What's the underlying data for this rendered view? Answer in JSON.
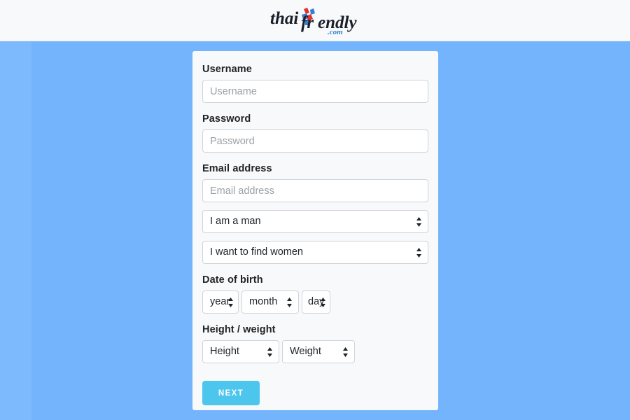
{
  "header": {
    "logo": {
      "name": "thaifriendly-logo",
      "text_part1": "thai",
      "text_part2": "fr",
      "text_part3": "endly",
      "domain_text": ".com",
      "colors": {
        "text": "#1b1f2a",
        "red": "#e8302f",
        "blue": "#2f7fd4",
        "domain": "#2f7fd4"
      }
    }
  },
  "page": {
    "background_color": "#74b4fd",
    "edge_strip_color": "#7cb9fd",
    "header_background": "#f8f9fa",
    "card_background": "#f8f9fa"
  },
  "form": {
    "username": {
      "label": "Username",
      "placeholder": "Username",
      "value": ""
    },
    "password": {
      "label": "Password",
      "placeholder": "Password",
      "value": ""
    },
    "email": {
      "label": "Email address",
      "placeholder": "Email address",
      "value": ""
    },
    "gender_select": {
      "selected": "I am a man"
    },
    "seeking_select": {
      "selected": "I want to find women"
    },
    "date_of_birth": {
      "label": "Date of birth",
      "year_selected": "year",
      "month_selected": "month",
      "day_selected": "day"
    },
    "height_weight": {
      "label": "Height / weight",
      "height_selected": "Height",
      "weight_selected": "Weight"
    },
    "submit": {
      "label": "NEXT",
      "color": "#4dc6ee"
    }
  }
}
